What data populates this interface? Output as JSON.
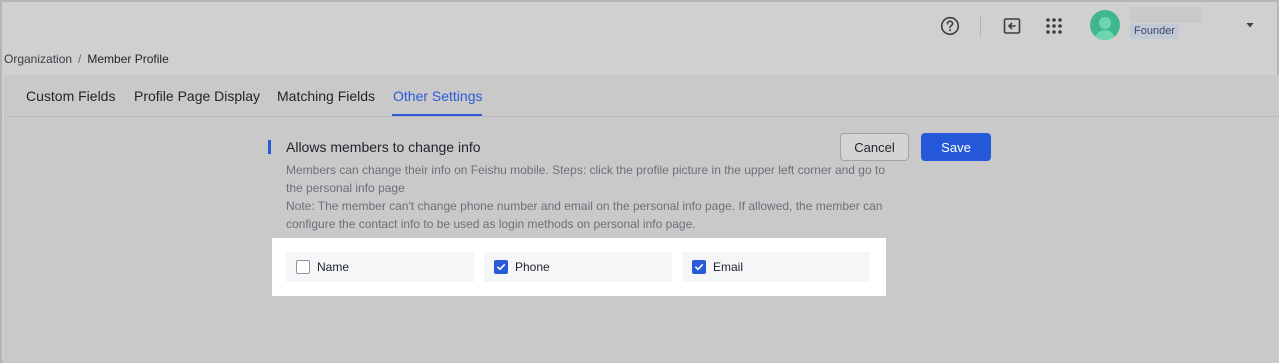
{
  "header": {
    "help_icon": "help-circle-icon",
    "switch_icon": "switch-account-icon",
    "apps_icon": "apps-grid-icon",
    "role": "Founder",
    "dropdown_icon": "caret-down-icon"
  },
  "breadcrumb": {
    "parent": "Organization",
    "separator": "/",
    "current": "Member Profile"
  },
  "tabs": [
    {
      "label": "Custom Fields",
      "active": false
    },
    {
      "label": "Profile Page Display",
      "active": false
    },
    {
      "label": "Matching Fields",
      "active": false
    },
    {
      "label": "Other Settings",
      "active": true
    }
  ],
  "section": {
    "title": "Allows members to change info",
    "description_line1": "Members can change their info on Feishu mobile. Steps: click the profile picture in the upper left corner and go to the personal info page",
    "description_line2": "Note: The member can't change phone number and email on the personal info page. If allowed, the member can configure the contact info to be used as login methods on personal info page."
  },
  "actions": {
    "cancel_label": "Cancel",
    "save_label": "Save"
  },
  "options": [
    {
      "label": "Name",
      "checked": false
    },
    {
      "label": "Phone",
      "checked": true
    },
    {
      "label": "Email",
      "checked": true
    }
  ],
  "colors": {
    "accent": "#2b5ad9",
    "save_button": "#2458d9",
    "avatar": "#3fb68e"
  }
}
